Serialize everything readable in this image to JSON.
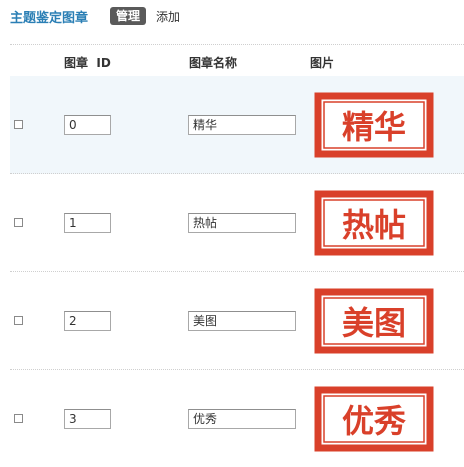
{
  "header": {
    "title": "主题鉴定图章",
    "tab_manage": "管理",
    "tab_add": "添加"
  },
  "table": {
    "headers": {
      "id": "图章  ID",
      "name": "图章名称",
      "image": "图片"
    },
    "rows": [
      {
        "id": "0",
        "name": "精华",
        "stamp_text": "精华",
        "highlighted": true
      },
      {
        "id": "1",
        "name": "热帖",
        "stamp_text": "热帖",
        "highlighted": false
      },
      {
        "id": "2",
        "name": "美图",
        "stamp_text": "美图",
        "highlighted": false
      },
      {
        "id": "3",
        "name": "优秀",
        "stamp_text": "优秀",
        "highlighted": false
      }
    ]
  },
  "colors": {
    "accent": "#2b7fb5",
    "stamp_red": "#d9402a",
    "highlight_bg": "#f1f7fb"
  }
}
